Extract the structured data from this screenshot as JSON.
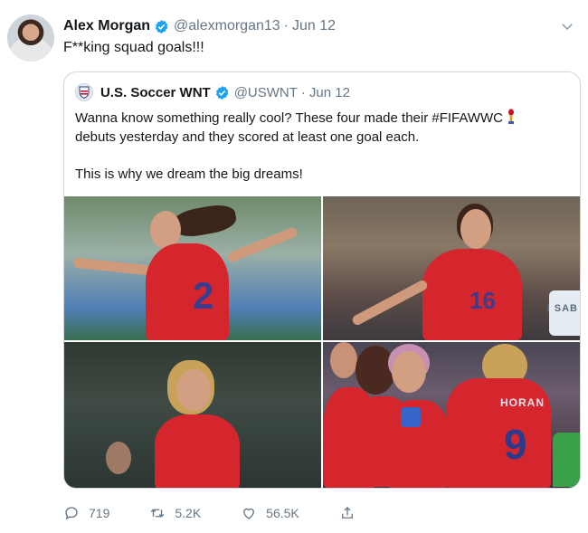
{
  "tweet": {
    "author_name": "Alex Morgan",
    "author_handle": "@alexmorgan13",
    "separator": "·",
    "time": "Jun 12",
    "text": "F**king squad goals!!!"
  },
  "quote": {
    "author_name": "U.S. Soccer WNT",
    "author_handle": "@USWNT",
    "separator": "·",
    "time": "Jun 12",
    "line1": "Wanna know something really cool? These four made their #FIFAWWC",
    "line2": "debuts yesterday and they scored at least one goal each.",
    "line3": "This is why we dream the big dreams!",
    "photo_labels": {
      "p1_number": "2",
      "p2_number": "16",
      "p4_name": "HORAN",
      "p4_number": "9",
      "p2_sign": "I SAB"
    }
  },
  "actions": {
    "replies": "719",
    "retweets": "5.2K",
    "likes": "56.5K"
  },
  "icons": [
    "verified-badge-icon",
    "chevron-down-icon",
    "trophy-icon",
    "reply-icon",
    "retweet-icon",
    "like-icon",
    "share-icon"
  ],
  "colors": {
    "accent": "#1da1f2",
    "muted": "#657786",
    "border": "#ccd6dd",
    "jersey": "#d6262d"
  }
}
